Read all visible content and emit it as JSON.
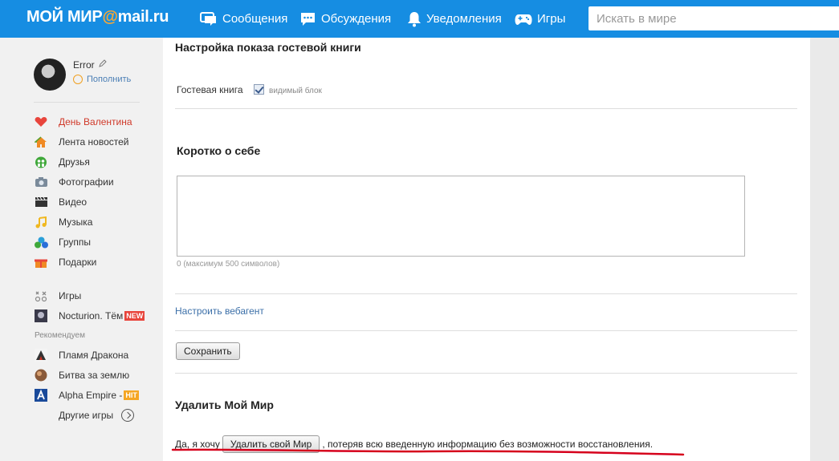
{
  "header": {
    "logo_main": "МОЙ МИР",
    "logo_at": "@",
    "logo_domain": "mail.ru",
    "nav": {
      "messages": "Сообщения",
      "discussions": "Обсуждения",
      "notifications": "Уведомления",
      "games": "Игры"
    },
    "search_placeholder": "Искать в мире"
  },
  "sidebar": {
    "profile": {
      "name": "Error",
      "replenish": "Пополнить"
    },
    "menu": [
      {
        "label": "День Валентина",
        "icon": "heart-icon"
      },
      {
        "label": "Лента новостей",
        "icon": "home-icon"
      },
      {
        "label": "Друзья",
        "icon": "friends-icon"
      },
      {
        "label": "Фотографии",
        "icon": "camera-icon"
      },
      {
        "label": "Видео",
        "icon": "video-icon"
      },
      {
        "label": "Музыка",
        "icon": "music-icon"
      },
      {
        "label": "Группы",
        "icon": "groups-icon"
      },
      {
        "label": "Подарки",
        "icon": "gift-icon"
      }
    ],
    "games": [
      {
        "label": "Игры",
        "icon": "games-icon"
      },
      {
        "label": "Nocturion. Тём",
        "badge": "NEW",
        "icon": "game-thumb"
      }
    ],
    "recommend_label": "Рекомендуем",
    "recommended": [
      {
        "label": "Пламя Дракона",
        "icon": "game-thumb"
      },
      {
        "label": "Битва за землю",
        "icon": "game-thumb"
      },
      {
        "label": "Alpha Empire -",
        "badge": "HIT",
        "icon": "alpha-icon"
      }
    ],
    "other_games": "Другие игры"
  },
  "main": {
    "guestbook_title": "Настройка показа гостевой книги",
    "guestbook_label": "Гостевая книга",
    "guestbook_checked": true,
    "visible_label": "видимый блок",
    "about_title": "Коротко о себе",
    "about_value": "",
    "char_count": "0 (максимум 500 символов)",
    "webagent_link": "Настроить вебагент",
    "save_label": "Сохранить",
    "delete_title": "Удалить Мой Мир",
    "delete_prefix": "Да, я хочу",
    "delete_button": "Удалить свой Мир",
    "delete_suffix": ", потеряв всю введенную информацию без возможности восстановления.",
    "accent_color": "#168de2",
    "annotation_color": "#d6001c"
  }
}
